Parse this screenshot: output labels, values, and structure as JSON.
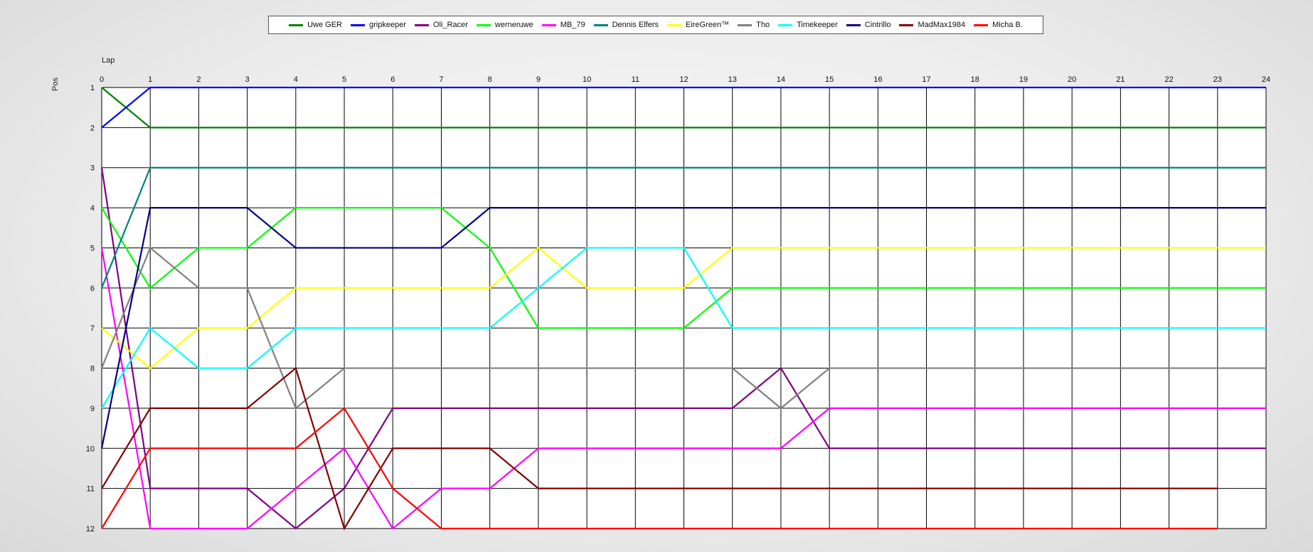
{
  "chart_data": {
    "type": "line",
    "title": "",
    "xlabel": "Lap",
    "ylabel": "Pos",
    "x": [
      0,
      1,
      2,
      3,
      4,
      5,
      6,
      7,
      8,
      9,
      10,
      11,
      12,
      13,
      14,
      15,
      16,
      17,
      18,
      19,
      20,
      21,
      22,
      23,
      24
    ],
    "xlim": [
      0,
      24
    ],
    "ylim": [
      1,
      12
    ],
    "y_inverted": true,
    "x_ticks": [
      "0",
      "1",
      "2",
      "3",
      "4",
      "5",
      "6",
      "7",
      "8",
      "9",
      "10",
      "11",
      "12",
      "13",
      "14",
      "15",
      "16",
      "17",
      "18",
      "19",
      "20",
      "21",
      "22",
      "23",
      "24"
    ],
    "y_ticks": [
      "1",
      "2",
      "3",
      "4",
      "5",
      "6",
      "7",
      "8",
      "9",
      "10",
      "11",
      "12"
    ],
    "grid": true,
    "legend_position": "top-center",
    "series": [
      {
        "name": "Uwe GER",
        "color": "#008000",
        "values": [
          1,
          2,
          2,
          2,
          2,
          2,
          2,
          2,
          2,
          2,
          2,
          2,
          2,
          2,
          2,
          2,
          2,
          2,
          2,
          2,
          2,
          2,
          2,
          2,
          2
        ]
      },
      {
        "name": "gripkeeper",
        "color": "#0000ff",
        "values": [
          2,
          1,
          1,
          1,
          1,
          1,
          1,
          1,
          1,
          1,
          1,
          1,
          1,
          1,
          1,
          1,
          1,
          1,
          1,
          1,
          1,
          1,
          1,
          1,
          1
        ]
      },
      {
        "name": "Oli_Racer",
        "color": "#800080",
        "values": [
          3,
          11,
          11,
          11,
          12,
          11,
          9,
          9,
          9,
          9,
          9,
          9,
          9,
          9,
          8,
          10,
          10,
          10,
          10,
          10,
          10,
          10,
          10,
          10,
          10
        ]
      },
      {
        "name": "werneruwe",
        "color": "#00ff00",
        "values": [
          4,
          6,
          5,
          5,
          4,
          4,
          4,
          4,
          5,
          7,
          7,
          7,
          7,
          6,
          6,
          6,
          6,
          6,
          6,
          6,
          6,
          6,
          6,
          6,
          6
        ]
      },
      {
        "name": "MB_79",
        "color": "#ff00ff",
        "values": [
          5,
          12,
          12,
          12,
          11,
          10,
          12,
          11,
          11,
          10,
          10,
          10,
          10,
          10,
          10,
          9,
          9,
          9,
          9,
          9,
          9,
          9,
          9,
          9,
          9
        ]
      },
      {
        "name": "Dennis Elfers",
        "color": "#008080",
        "values": [
          6,
          3,
          3,
          3,
          3,
          3,
          3,
          3,
          3,
          3,
          3,
          3,
          3,
          3,
          3,
          3,
          3,
          3,
          3,
          3,
          3,
          3,
          3,
          3,
          3
        ]
      },
      {
        "name": "EireGreen™",
        "color": "#ffff00",
        "values": [
          7,
          8,
          7,
          7,
          6,
          6,
          6,
          6,
          6,
          5,
          6,
          6,
          6,
          5,
          5,
          5,
          5,
          5,
          5,
          5,
          5,
          5,
          5,
          5,
          5
        ]
      },
      {
        "name": "Tho",
        "color": "#808080",
        "values": [
          8,
          5,
          6,
          6,
          9,
          8,
          8,
          8,
          8,
          8,
          8,
          8,
          8,
          8,
          9,
          8,
          8,
          8,
          8,
          8,
          8,
          8,
          8,
          8,
          8
        ]
      },
      {
        "name": "Timekeeper",
        "color": "#00ffff",
        "values": [
          9,
          7,
          8,
          8,
          7,
          7,
          7,
          7,
          7,
          6,
          5,
          5,
          5,
          7,
          7,
          7,
          7,
          7,
          7,
          7,
          7,
          7,
          7,
          7,
          7
        ]
      },
      {
        "name": "Cintrillo",
        "color": "#000080",
        "values": [
          10,
          4,
          4,
          4,
          5,
          5,
          5,
          5,
          4,
          4,
          4,
          4,
          4,
          4,
          4,
          4,
          4,
          4,
          4,
          4,
          4,
          4,
          4,
          4,
          4
        ]
      },
      {
        "name": "MadMax1984",
        "color": "#800000",
        "values": [
          11,
          9,
          9,
          9,
          8,
          12,
          10,
          10,
          10,
          11,
          11,
          11,
          11,
          11,
          11,
          11,
          11,
          11,
          11,
          11,
          11,
          11,
          11,
          11
        ]
      },
      {
        "name": "Micha B.",
        "color": "#ff0000",
        "values": [
          12,
          10,
          10,
          10,
          10,
          9,
          11,
          12,
          12,
          12,
          12,
          12,
          12,
          12,
          12,
          12,
          12,
          12,
          12,
          12,
          12,
          12,
          12,
          12
        ]
      }
    ]
  }
}
